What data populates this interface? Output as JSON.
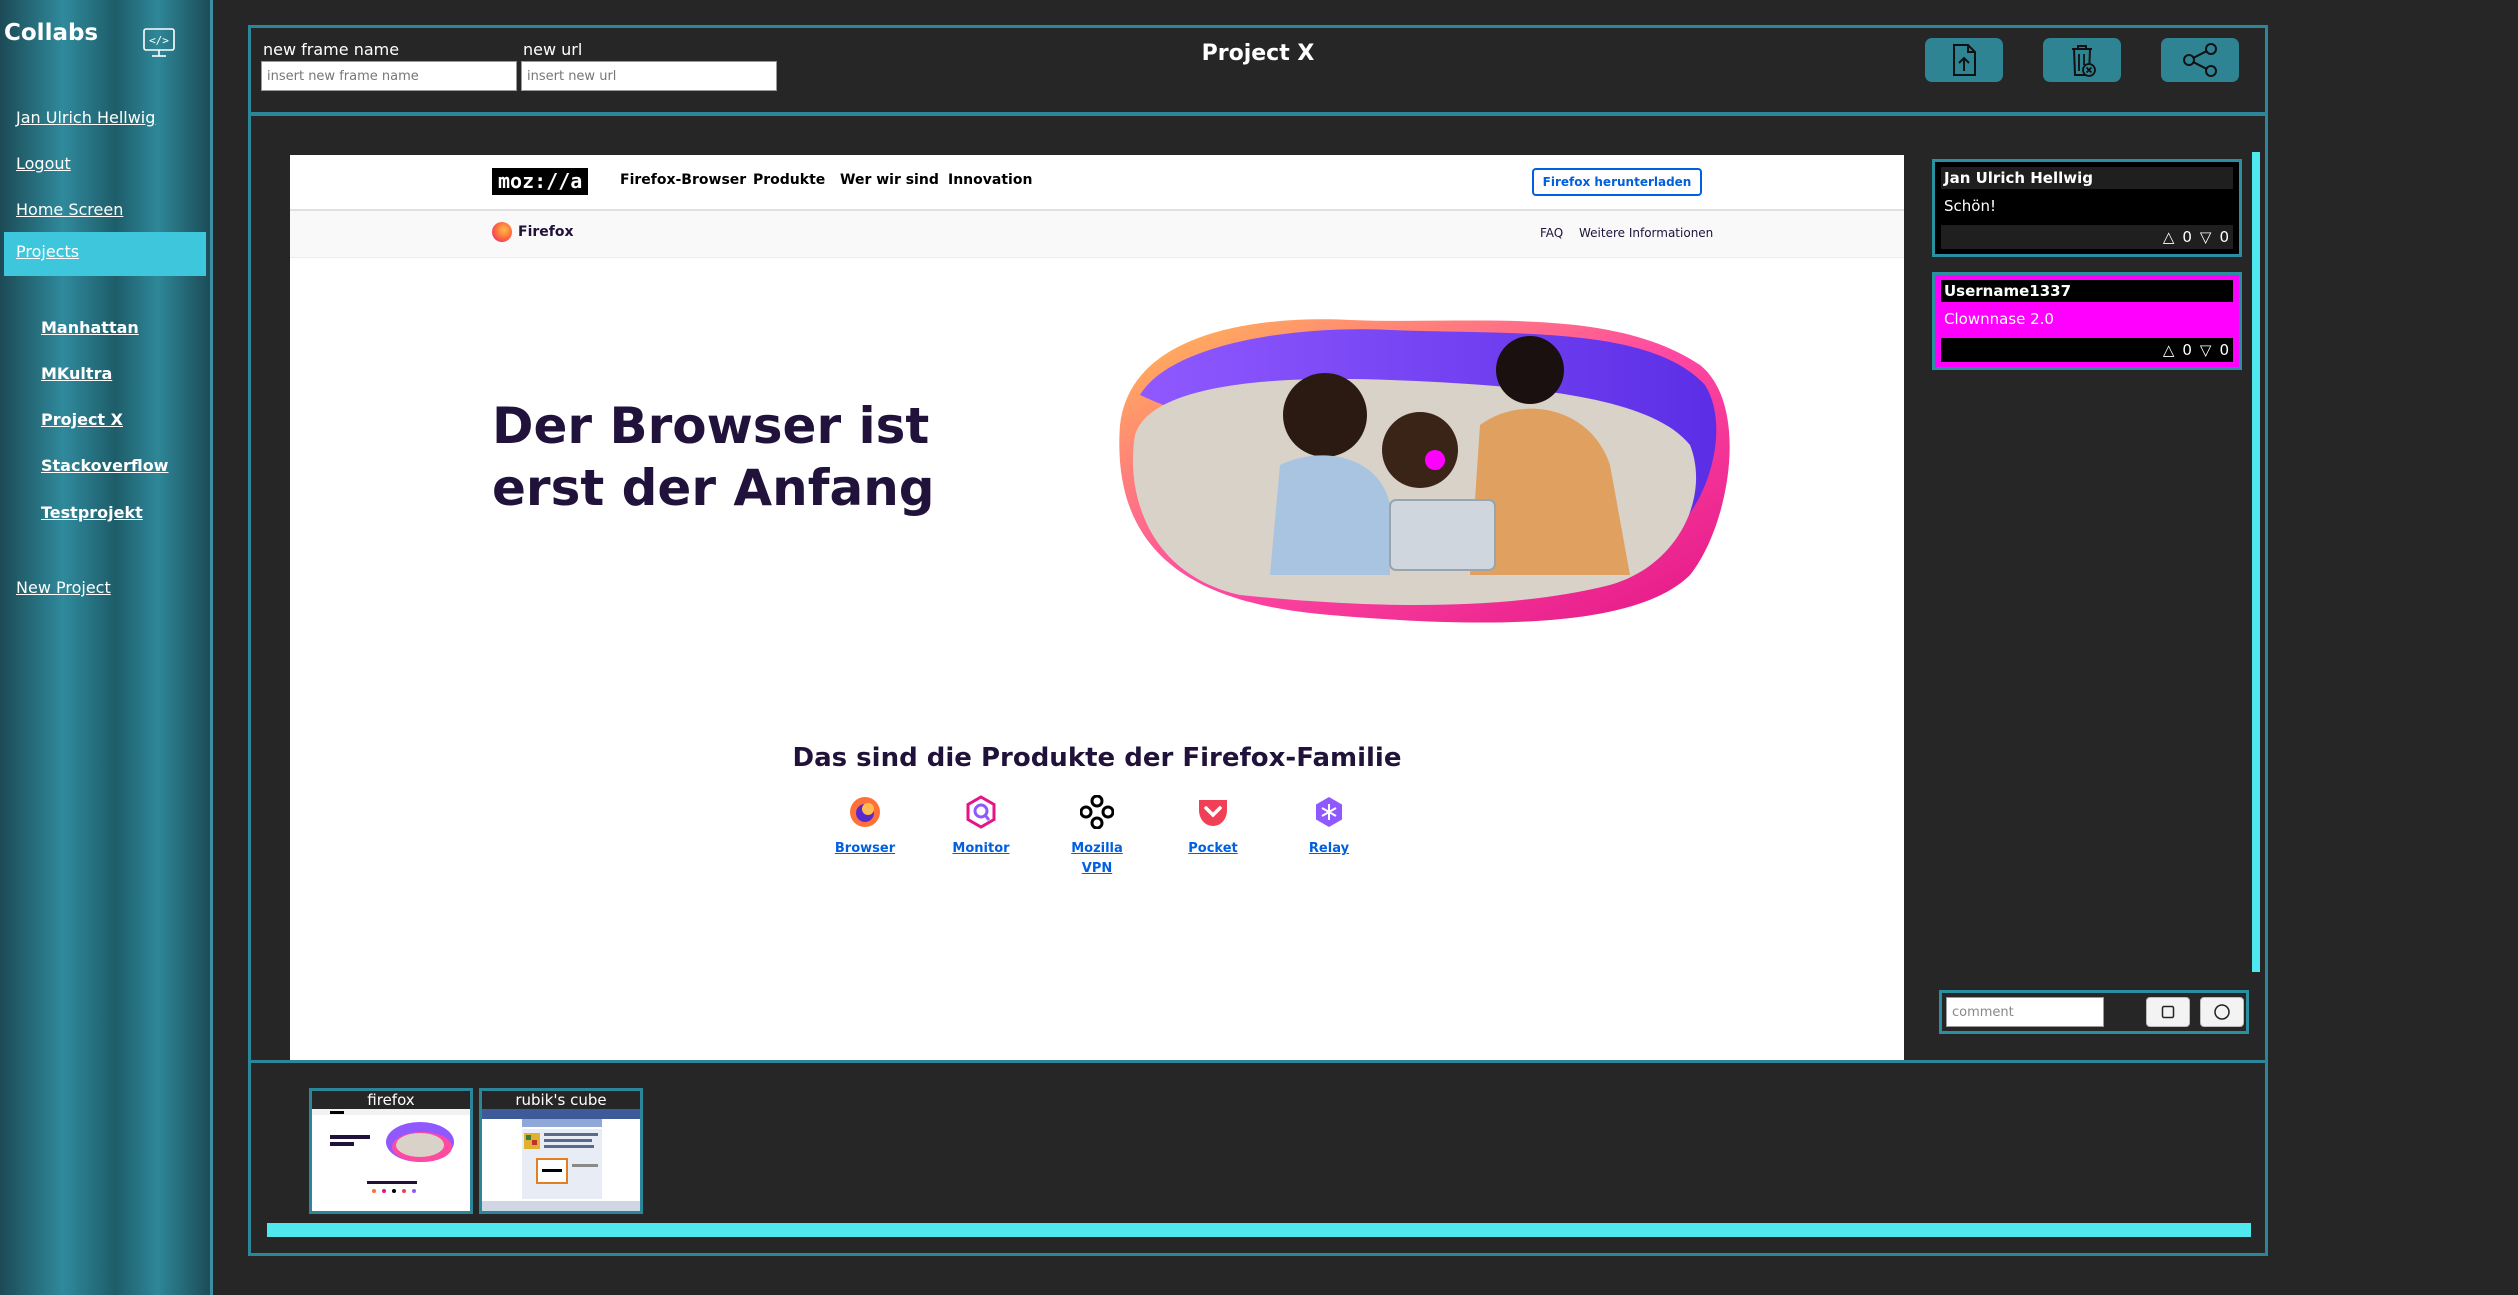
{
  "app": {
    "title": "Collabs",
    "code_icon": "code-icon"
  },
  "sidebar": {
    "user_name": "Jan Ulrich Hellwig",
    "logout": "Logout",
    "home": "Home Screen",
    "projects": "Projects",
    "project_list": [
      "Manhattan",
      "MKultra",
      "Project X",
      "Stackoverflow",
      "Testprojekt"
    ],
    "new_project": "New Project"
  },
  "topbar": {
    "frame_name_label": "new frame name",
    "frame_name_placeholder": "insert new frame name",
    "url_label": "new url",
    "url_placeholder": "insert new url",
    "project_title": "Project X",
    "buttons": [
      "upload-file-icon",
      "delete-trash-icon",
      "share-icon"
    ]
  },
  "frame_page": {
    "logo": "moz://a",
    "nav": [
      "Firefox-Browser",
      "Produkte",
      "Wer wir sind",
      "Innovation"
    ],
    "download_button": "Firefox herunterladen",
    "subnav_brand": "Firefox",
    "subnav_links": [
      "FAQ",
      "Weitere Informationen"
    ],
    "hero_heading": "Der Browser ist erst der Anfang",
    "products_heading": "Das sind die Produkte der Firefox-Familie",
    "products": [
      "Browser",
      "Monitor",
      "Mozilla VPN",
      "Pocket",
      "Relay"
    ]
  },
  "comments": [
    {
      "user": "Jan Ulrich Hellwig",
      "text": "Schön!",
      "up": "0",
      "down": "0",
      "color": "#000000"
    },
    {
      "user": "Username1337",
      "text": "Clownnase 2.0",
      "up": "0",
      "down": "0",
      "color": "#ff00ff"
    }
  ],
  "comment_bar": {
    "placeholder": "comment",
    "shape_buttons": [
      "square-icon",
      "circle-icon"
    ]
  },
  "frames": [
    {
      "title": "firefox"
    },
    {
      "title": "rubik's cube"
    }
  ],
  "colors": {
    "accent": "#3ec7dc",
    "border": "#2b8699",
    "scrollbar": "#4ee8ee",
    "background": "#262626",
    "highlight": "#ff00ff"
  }
}
